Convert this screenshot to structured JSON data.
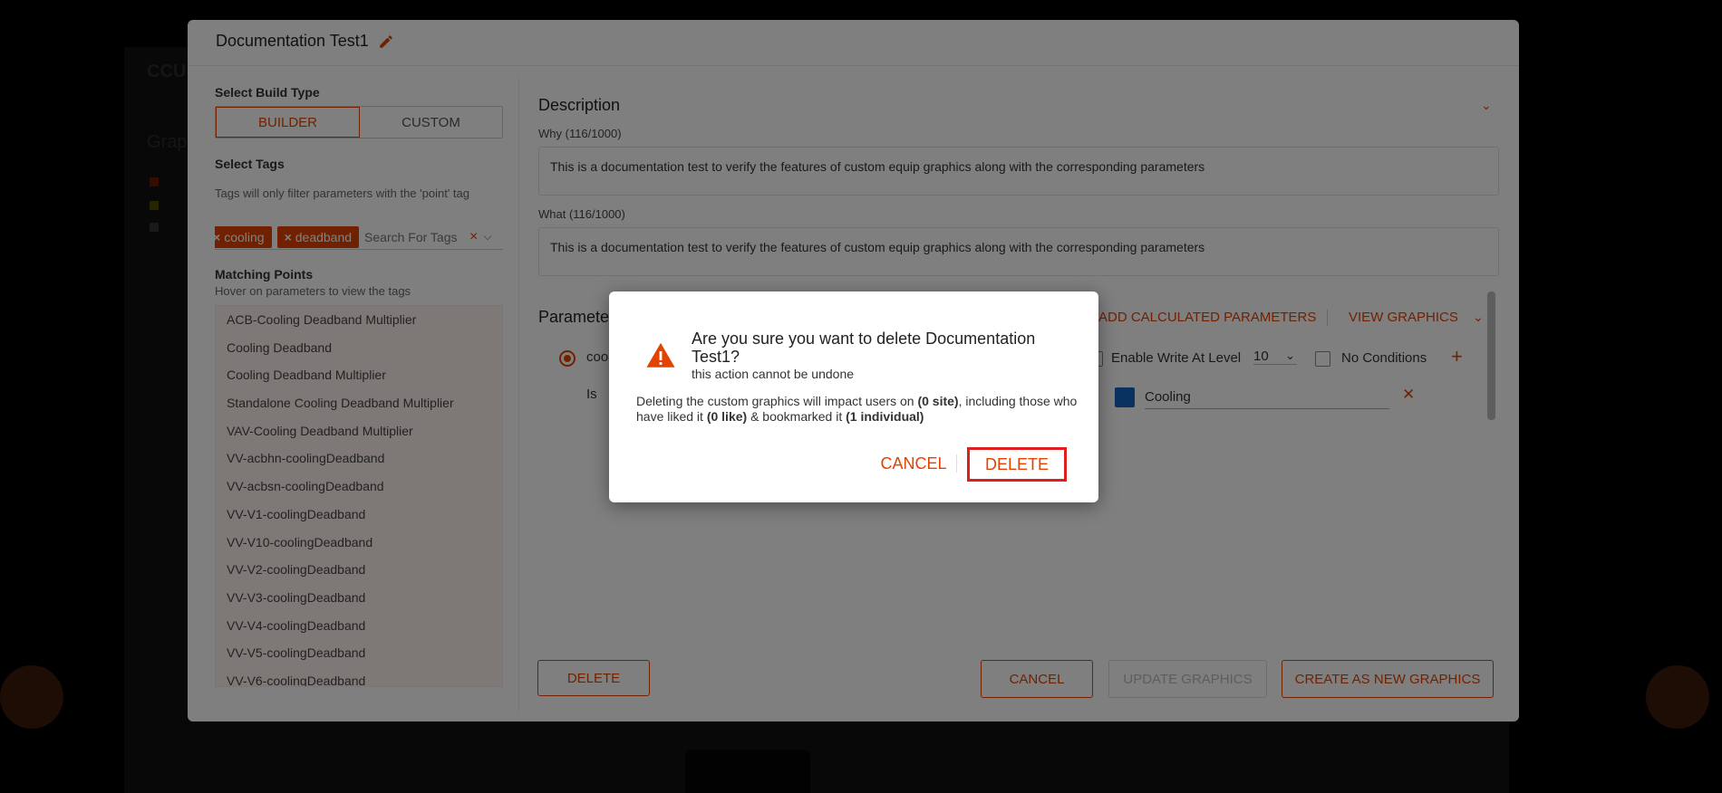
{
  "modal": {
    "title": "Documentation Test1",
    "build_type_label": "Select Build Type",
    "build_type_options": [
      "BUILDER",
      "CUSTOM"
    ],
    "select_tags_label": "Select Tags",
    "tags_help": "Tags will only filter parameters with the 'point' tag",
    "tags": [
      "cooling",
      "deadband"
    ],
    "tag_search_placeholder": "Search For Tags",
    "matching_points_label": "Matching Points",
    "matching_points_help": "Hover on parameters to view the tags",
    "points": [
      "ACB-Cooling Deadband Multiplier",
      "Cooling Deadband",
      "Cooling Deadband Multiplier",
      "Standalone Cooling Deadband Multiplier",
      "VAV-Cooling Deadband Multiplier",
      "VV-acbhn-coolingDeadband",
      "VV-acbsn-coolingDeadband",
      "VV-V1-coolingDeadband",
      "VV-V10-coolingDeadband",
      "VV-V2-coolingDeadband",
      "VV-V3-coolingDeadband",
      "VV-V4-coolingDeadband",
      "VV-V5-coolingDeadband",
      "VV-V6-coolingDeadband"
    ],
    "description_title": "Description",
    "why_label": "Why (116/1000)",
    "why_text": "This is a documentation test to verify the features of custom equip graphics along with the corresponding parameters",
    "what_label": "What (116/1000)",
    "what_text": "This is a documentation test to verify the features of custom equip graphics along with the corresponding parameters",
    "parameters_title": "Parameters",
    "add_calculated": "ADD CALCULATED PARAMETERS",
    "view_graphics": "VIEW GRAPHICS",
    "param_name_partial": "coo",
    "is_label": "Is",
    "enable_write": "Enable Write At Level",
    "write_level": "10",
    "no_conditions": "No Conditions",
    "cooling_value": "Cooling",
    "delete_button": "DELETE",
    "cancel_button": "CANCEL",
    "update_button": "UPDATE GRAPHICS",
    "create_button": "CREATE AS NEW GRAPHICS",
    "colors": {
      "accent": "#e24301",
      "swatch": "#1565c0"
    }
  },
  "background": {
    "title": "CCU",
    "subtitle": "Grap"
  },
  "dialog": {
    "title": "Are you sure you want to delete Documentation Test1?",
    "subtitle": "this action cannot be undone",
    "body_pre": "Deleting the custom graphics will impact users on ",
    "sites": "(0 site)",
    "body_mid1": ", including those who have liked it ",
    "likes": "(0 like)",
    "body_mid2": " & bookmarked it ",
    "bookmarks": "(1 individual)",
    "cancel": "CANCEL",
    "delete": "DELETE",
    "icon": "warning-icon"
  }
}
